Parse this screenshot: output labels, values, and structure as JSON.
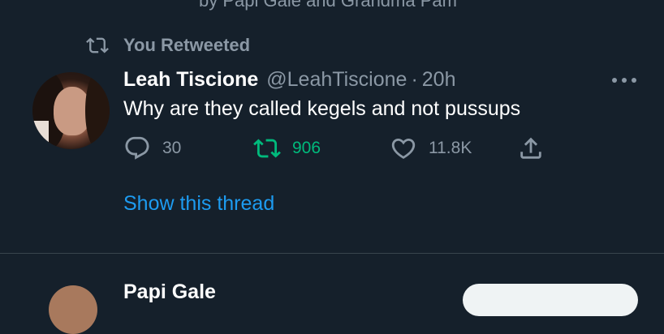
{
  "top_cut_text": "by Papi Gale and Grandma Pam",
  "retweet": {
    "label": "You Retweeted",
    "icon": "retweet-icon"
  },
  "tweet": {
    "name": "Leah Tiscione",
    "handle": "@LeahTiscione",
    "separator": "·",
    "time": "20h",
    "text": "Why are they called kegels and not pussups",
    "more_icon": "more-dots-icon",
    "actions": {
      "reply": {
        "icon": "reply-icon",
        "count": "30"
      },
      "retweet": {
        "icon": "retweet-icon",
        "count": "906",
        "active_color": "#00ba7c"
      },
      "like": {
        "icon": "heart-icon",
        "count": "11.8K"
      },
      "share": {
        "icon": "share-icon"
      }
    },
    "show_thread": "Show this thread"
  },
  "next_tweet": {
    "name": "Papi Gale"
  },
  "colors": {
    "background": "#15202b",
    "secondary_text": "#8b98a5",
    "link": "#1d9bf0",
    "divider": "#38444d"
  }
}
